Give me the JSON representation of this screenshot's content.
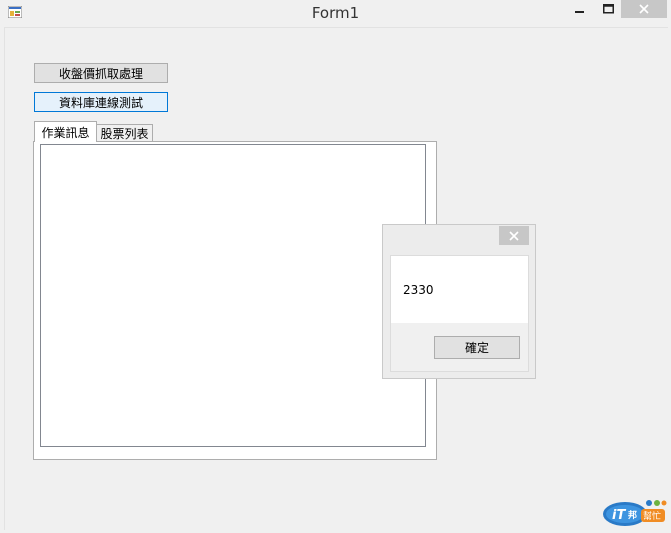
{
  "window": {
    "title": "Form1"
  },
  "buttons": {
    "fetch_closing_price": "收盤價抓取處理",
    "db_connection_test": "資料庫連線測試"
  },
  "tabs": [
    {
      "label": "作業訊息",
      "active": true
    },
    {
      "label": "股票列表",
      "active": false
    }
  ],
  "message_box": {
    "message": "2330",
    "ok_label": "確定"
  },
  "icons": {
    "app": "app-icon",
    "minimize": "minimize-icon",
    "maximize": "maximize-icon",
    "close": "close-icon"
  },
  "watermark": {
    "text": "iT邦幫忙"
  }
}
